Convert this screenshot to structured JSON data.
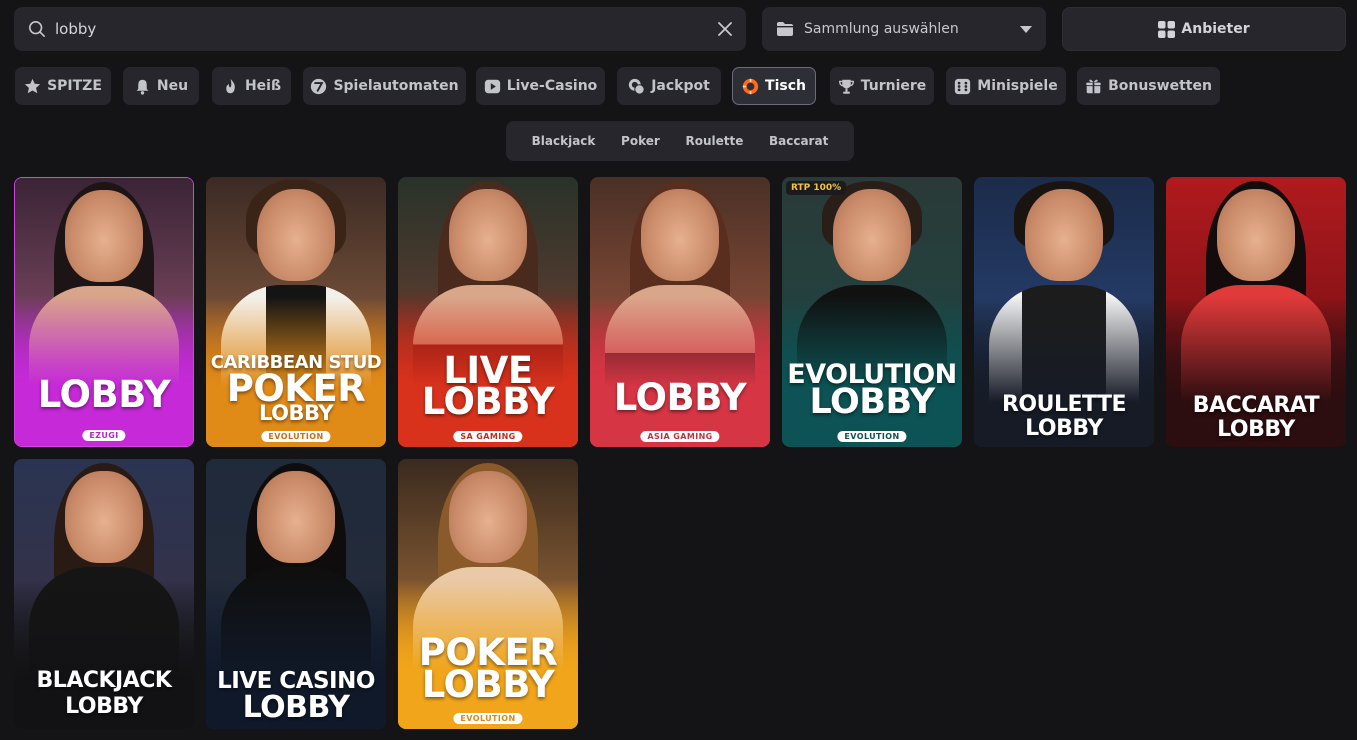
{
  "search": {
    "value": "lobby",
    "placeholder": ""
  },
  "collection": {
    "label": "Sammlung auswählen"
  },
  "provider_button": {
    "label": "Anbieter"
  },
  "tabs": [
    {
      "label": "SPITZE",
      "icon": "star-icon"
    },
    {
      "label": "Neu",
      "icon": "bell-icon"
    },
    {
      "label": "Heiß",
      "icon": "flame-icon"
    },
    {
      "label": "Spielautomaten",
      "icon": "slot-seven-icon"
    },
    {
      "label": "Live-Casino",
      "icon": "play-icon"
    },
    {
      "label": "Jackpot",
      "icon": "coins-icon"
    },
    {
      "label": "Tisch",
      "icon": "chip-icon",
      "active": true
    },
    {
      "label": "Turniere",
      "icon": "trophy-icon"
    },
    {
      "label": "Minispiele",
      "icon": "dice-icon"
    },
    {
      "label": "Bonuswetten",
      "icon": "gift-icon"
    }
  ],
  "subtabs": [
    "Blackjack",
    "Poker",
    "Roulette",
    "Baccarat"
  ],
  "games": [
    {
      "line1": "",
      "line2": "LOBBY",
      "line3": "",
      "provider": "EZUGI",
      "rtp": ""
    },
    {
      "line1": "CARIBBEAN STUD",
      "line2": "POKER",
      "line3": "LOBBY",
      "provider": "EVOLUTION",
      "rtp": ""
    },
    {
      "line1": "LIVE",
      "line2": "LOBBY",
      "line3": "",
      "provider": "SA GAMING",
      "rtp": ""
    },
    {
      "line1": "",
      "line2": "LOBBY",
      "line3": "",
      "provider": "ASIA GAMING",
      "rtp": ""
    },
    {
      "line1": "EVOLUTION",
      "line2": "LOBBY",
      "line3": "",
      "provider": "EVOLUTION",
      "rtp": "RTP 100%"
    },
    {
      "line1": "ROULETTE",
      "line2": "LOBBY",
      "line3": "",
      "provider": "",
      "rtp": ""
    },
    {
      "line1": "BACCARAT",
      "line2": "LOBBY",
      "line3": "",
      "provider": "",
      "rtp": ""
    },
    {
      "line1": "BLACKJACK",
      "line2": "LOBBY",
      "line3": "",
      "provider": "",
      "rtp": ""
    },
    {
      "line1": "LIVE CASINO",
      "line2": "LOBBY",
      "line3": "",
      "provider": "",
      "rtp": ""
    },
    {
      "line1": "POKER",
      "line2": "LOBBY",
      "line3": "",
      "provider": "EVOLUTION",
      "rtp": ""
    }
  ],
  "colors": {
    "background": "#141417",
    "panel": "#26262c",
    "tisch_icon": "#ff6a1f",
    "rtp_text": "#f3c247"
  }
}
